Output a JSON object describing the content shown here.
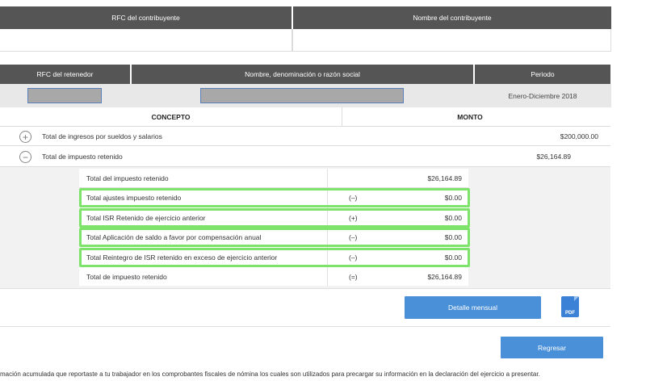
{
  "contribuyente": {
    "rfc_header": "RFC del contribuyente",
    "nombre_header": "Nombre del contribuyente"
  },
  "retenedor": {
    "rfc_header": "RFC del retenedor",
    "nombre_header": "Nombre, denominación o razón social",
    "periodo_header": "Periodo",
    "periodo_value": "Enero-Diciembre 2018"
  },
  "table": {
    "concepto_header": "CONCEPTO",
    "monto_header": "MONTO",
    "rows": [
      {
        "label": "Total de ingresos por sueldos y salarios",
        "amount": "$200,000.00",
        "icon": "+"
      },
      {
        "label": "Total de impuesto retenido",
        "amount": "$26,164.89",
        "icon": "−"
      }
    ]
  },
  "detail": [
    {
      "label": "Total del impuesto retenido",
      "sign": "",
      "amount": "$26,164.89"
    },
    {
      "label": "Total ajustes impuesto retenido",
      "sign": "(–)",
      "amount": "$0.00"
    },
    {
      "label": "Total ISR Retenido de ejercicio anterior",
      "sign": "(+)",
      "amount": "$0.00"
    },
    {
      "label": "Total Aplicación de saldo a favor por compensación anual",
      "sign": "(–)",
      "amount": "$0.00"
    },
    {
      "label": "Total Reintegro de ISR retenido en exceso de ejercicio anterior",
      "sign": "(–)",
      "amount": "$0.00"
    },
    {
      "label": "Total de impuesto retenido",
      "sign": "(=)",
      "amount": "$26,164.89"
    }
  ],
  "buttons": {
    "detalle": "Detalle mensual",
    "regresar": "Regresar",
    "pdf": "PDF"
  },
  "footer_text": "mación acumulada que reportaste a tu trabajador en los comprobantes fiscales de nómina los cuales son utilizados para precargar su información en la declaración del ejercicio a presentar.",
  "colors": {
    "header_bg": "#555555",
    "button": "#4a90d9",
    "highlight": "#7ee36b"
  }
}
